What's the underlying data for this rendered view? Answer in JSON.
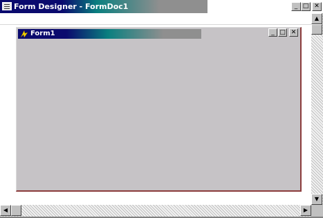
{
  "window": {
    "title": "Form Designer - FormDoc1",
    "icon": "form-designer-icon",
    "minimize_glyph": "_",
    "maximize_glyph": "□",
    "close_glyph": "✕"
  },
  "form": {
    "title": "Form1",
    "icon": "form-icon",
    "minimize_glyph": "_",
    "maximize_glyph": "□",
    "close_glyph": "✕"
  },
  "scrollbars": {
    "up_glyph": "▲",
    "down_glyph": "▼",
    "left_glyph": "◀",
    "right_glyph": "▶"
  },
  "colors": {
    "title_active": "#0a0a6e",
    "title_gradient_mid": "#0a7f7f",
    "form_background": "#c6c3c6",
    "form_border_accent": "#8c3c3c"
  }
}
